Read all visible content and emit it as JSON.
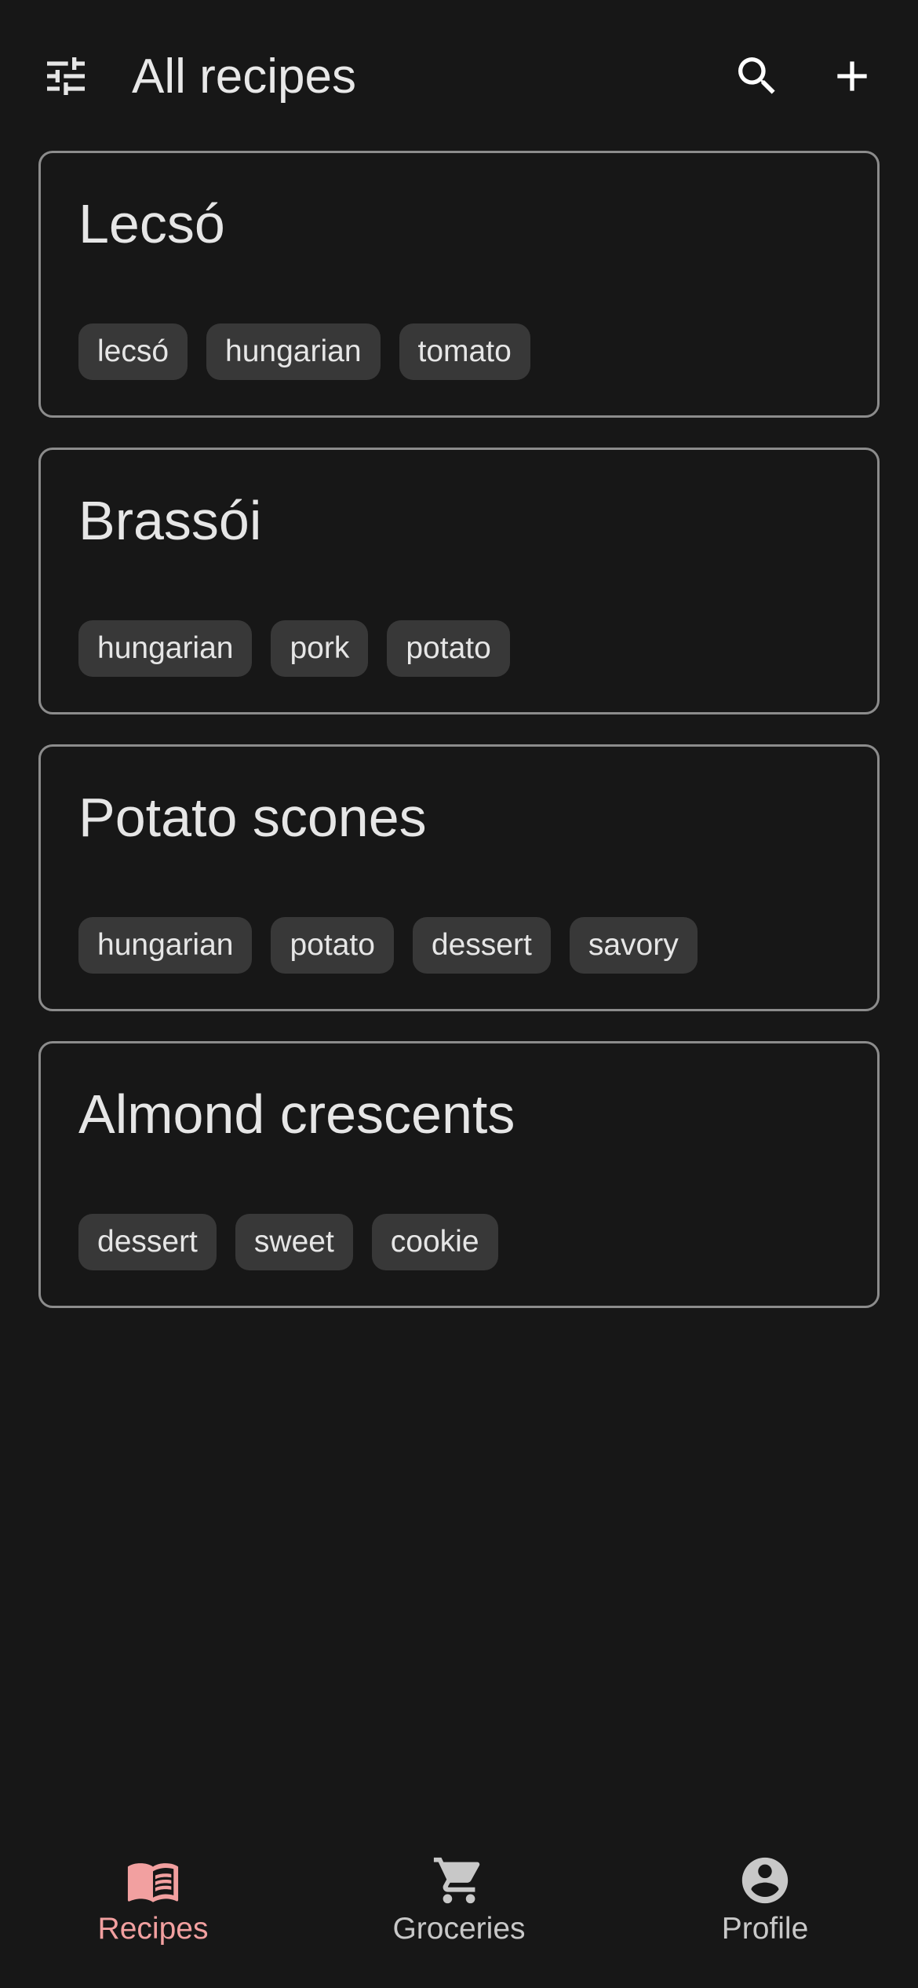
{
  "header": {
    "title": "All recipes",
    "filter_icon": "tune-icon",
    "search_icon": "search-icon",
    "add_icon": "plus-icon"
  },
  "recipes": [
    {
      "title": "Lecsó",
      "tags": [
        "lecsó",
        "hungarian",
        "tomato"
      ]
    },
    {
      "title": "Brassói",
      "tags": [
        "hungarian",
        "pork",
        "potato"
      ]
    },
    {
      "title": "Potato scones",
      "tags": [
        "hungarian",
        "potato",
        "dessert",
        "savory"
      ]
    },
    {
      "title": "Almond crescents",
      "tags": [
        "dessert",
        "sweet",
        "cookie"
      ]
    }
  ],
  "bottom_nav": {
    "items": [
      {
        "label": "Recipes",
        "icon": "book-icon",
        "active": true
      },
      {
        "label": "Groceries",
        "icon": "cart-icon",
        "active": false
      },
      {
        "label": "Profile",
        "icon": "account-circle-icon",
        "active": false
      }
    ]
  },
  "colors": {
    "background": "#171717",
    "card_border": "#8c8c8c",
    "chip_bg": "#383838",
    "accent": "#f2a0a0",
    "text": "#e6e6e6"
  }
}
